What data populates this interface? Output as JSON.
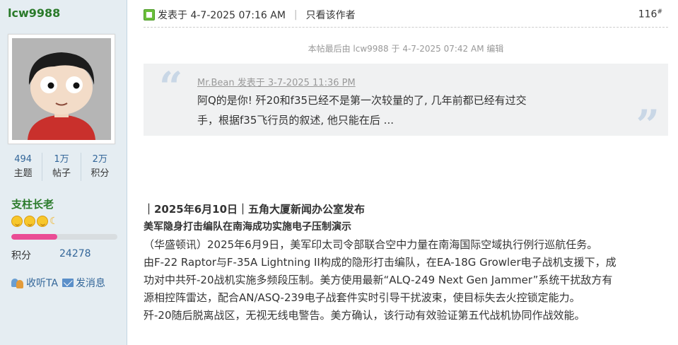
{
  "author": {
    "username": "lcw9988",
    "stats": [
      {
        "value": "494",
        "label": "主题"
      },
      {
        "value": "1万",
        "label": "帖子"
      },
      {
        "value": "2万",
        "label": "积分"
      }
    ],
    "rank": "支柱长老",
    "medal_count": 3,
    "progress_fraction": 0.43,
    "score_label": "积分",
    "score_value": "24278",
    "follow_label": "收听TA",
    "message_label": "发消息"
  },
  "post": {
    "posted_at": "发表于 4-7-2025 07:16 AM",
    "separator": "|",
    "only_author": "只看该作者",
    "floor": "116",
    "floor_mark": "#",
    "edited_note": "本帖最后由 lcw9988 于 4-7-2025 07:42 AM 编辑",
    "quote": {
      "meta": "Mr.Bean 发表于 3-7-2025 11:36 PM",
      "line1": "阿Q的是你! 歼20和f35已经不是第一次较量的了, 几年前都已经有过交",
      "line2": "手，根据f35飞行员的叙述, 他只能在后 ..."
    },
    "headline1": "｜2025年6月10日｜五角大厦新闻办公室发布",
    "headline2": "美军隐身打击编队在南海成功实施电子压制演示",
    "lines": [
      "（华盛顿讯）2025年6月9日，美军印太司令部联合空中力量在南海国际空域执行例行巡航任务。",
      "由F-22 Raptor与F-35A Lightning II构成的隐形打击编队，在EA-18G Growler电子战机支援下，成",
      "功对中共歼-20战机实施多频段压制。美方使用最新“ALQ-249 Next Gen Jammer”系统干扰敌方有",
      "源相控阵雷达，配合AN/ASQ-239电子战套件实时引导干扰波束，使目标失去火控锁定能力。",
      "歼-20随后脱离战区，无视无线电警告。美方确认，该行动有效验证第五代战机协同作战效能。"
    ]
  }
}
